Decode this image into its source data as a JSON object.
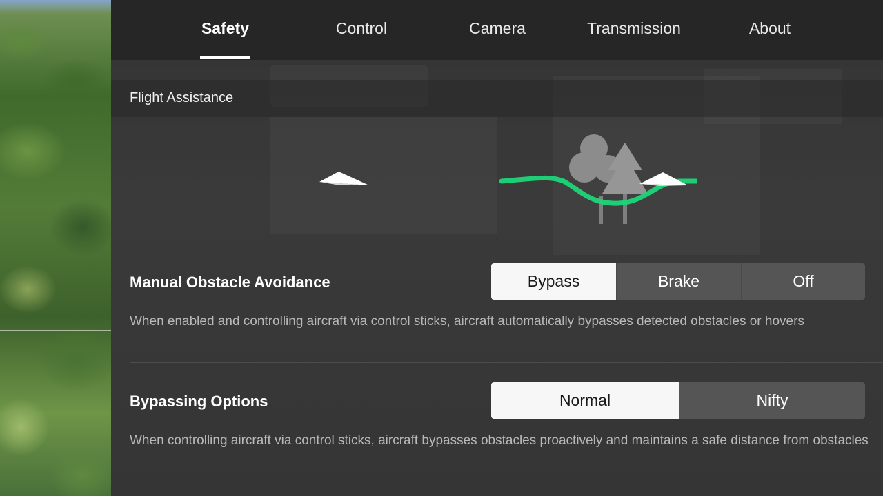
{
  "tabs": [
    {
      "label": "Safety",
      "active": true
    },
    {
      "label": "Control",
      "active": false
    },
    {
      "label": "Camera",
      "active": false
    },
    {
      "label": "Transmission",
      "active": false
    },
    {
      "label": "About",
      "active": false
    }
  ],
  "section": {
    "title": "Flight Assistance"
  },
  "illustration": {
    "icons": [
      "paper-plane-icon",
      "tree-icon",
      "bypass-arrow-icon",
      "paper-plane-icon"
    ],
    "accent": "#1fd57a"
  },
  "settings": [
    {
      "label": "Manual Obstacle Avoidance",
      "options": [
        "Bypass",
        "Brake",
        "Off"
      ],
      "selected": "Bypass",
      "description": "When enabled and controlling aircraft via control sticks, aircraft automatically bypasses detected obstacles or hovers"
    },
    {
      "label": "Bypassing Options",
      "options": [
        "Normal",
        "Nifty"
      ],
      "selected": "Normal",
      "description": "When controlling aircraft via control sticks, aircraft bypasses obstacles proactively and maintains a safe distance from obstacles"
    }
  ],
  "colors": {
    "panel": "#333333",
    "tabbar": "#262626",
    "selected_segment": "#f7f7f7",
    "segment": "#555555"
  }
}
